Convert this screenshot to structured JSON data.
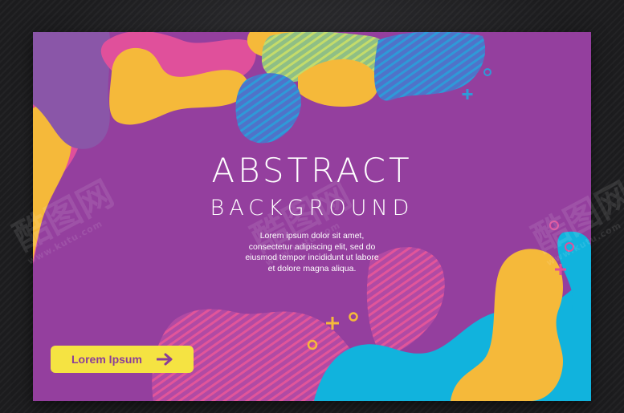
{
  "card": {
    "title": "ABSTRACT",
    "subtitle": "BACKGROUND",
    "body_lines": [
      "Lorem ipsum dolor sit amet,",
      "consectetur adipiscing elit, sed do",
      "eiusmod tempor incididunt ut labore",
      "et dolore magna aliqua."
    ],
    "cta_label": "Lorem Ipsum"
  },
  "watermarks": [
    {
      "text": "酷图网",
      "url": "www.kutu.com"
    },
    {
      "text": "酷图网",
      "url": "www.kutu.com"
    },
    {
      "text": "酷图网",
      "url": "www.kutu.com"
    }
  ],
  "colors": {
    "background": "#943f9e",
    "yellow": "#f5b93a",
    "pink": "#e0509b",
    "blue": "#3b86d6",
    "cyan": "#11b3dd",
    "button": "#f5e342",
    "button_text": "#8a3e99",
    "text": "#ffffff"
  }
}
